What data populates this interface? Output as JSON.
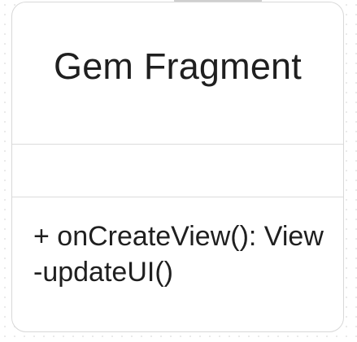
{
  "diagram": {
    "class_name": "Gem Fragment",
    "attributes": [],
    "methods": [
      "+ onCreateView(): View",
      "-updateUI()"
    ]
  }
}
